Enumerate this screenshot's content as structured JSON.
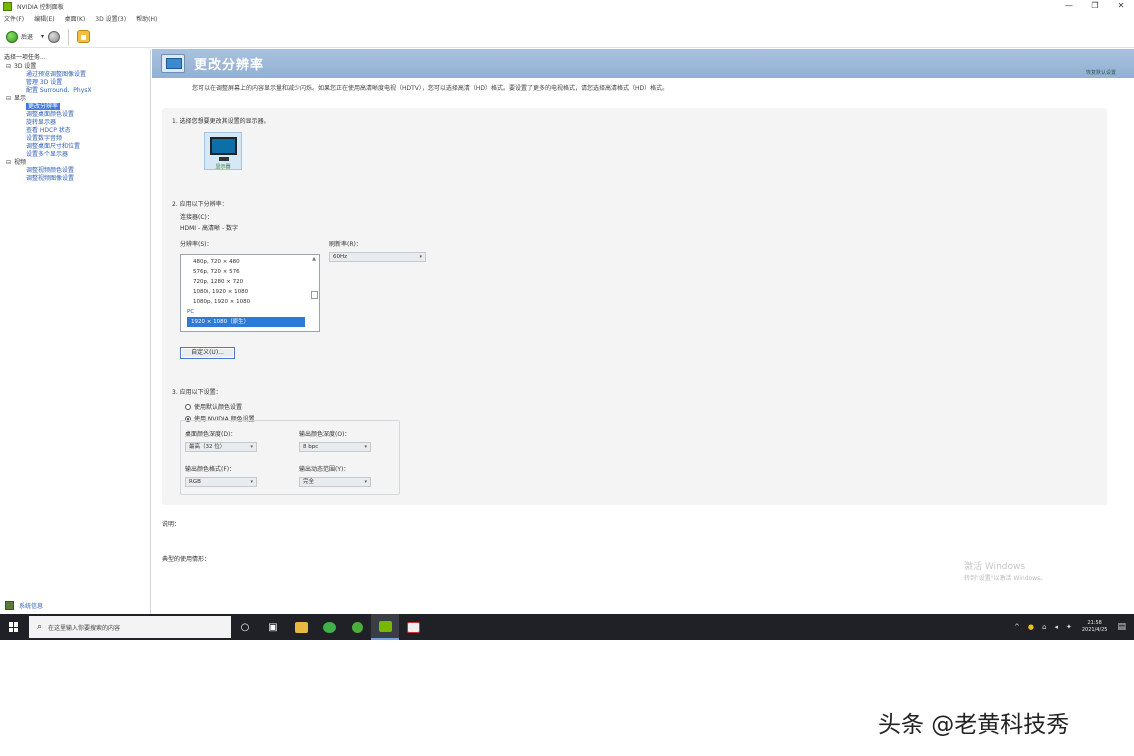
{
  "window": {
    "title": "NVIDIA 控制面板",
    "minimize": "—",
    "maximize": "❐",
    "close": "✕"
  },
  "menu": [
    "文件(F)",
    "编辑(E)",
    "桌面(K)",
    "3D 设置(3)",
    "帮助(H)"
  ],
  "toolbar": {
    "back_label": "后退",
    "dropdown_arrow": "▾"
  },
  "sidebar": {
    "header": "选择一项任务...",
    "categories": [
      {
        "name": "3D 设置",
        "expand": "⊟",
        "items": [
          "通过预览调整图像设置",
          "管理 3D 设置",
          "配置 Surround、PhysX"
        ]
      },
      {
        "name": "显示",
        "expand": "⊟",
        "items": [
          "更改分辨率",
          "调整桌面颜色设置",
          "旋转显示器",
          "查看 HDCP 状态",
          "设置数字音频",
          "调整桌面尺寸和位置",
          "设置多个显示器"
        ]
      },
      {
        "name": "视频",
        "expand": "⊟",
        "items": [
          "调整视频颜色设置",
          "调整视频图像设置"
        ]
      }
    ],
    "selected": "更改分辨率",
    "footer_link": "系统信息"
  },
  "main": {
    "banner_title": "更改分辨率",
    "restore_defaults": "恢复默认设置",
    "description": "您可以在调整屏幕上的内容显示量和减少闪烁。如果您正在使用高清晰度电视（HDTV），您可以选择高清（HD）格式。要设置了更多的电视格式，请您选择高清格式（HD）格式。",
    "section1": "1. 选择您想要更改其设置的显示器。",
    "monitor_label": "显示器",
    "section2": "2. 应用以下分辨率：",
    "connector_label": "连接器(C)：",
    "connector_value": "HDMI - 高清晰 - 数字",
    "resolution_label": "分辨率(S)：",
    "refresh_label": "刷新率(R)：",
    "refresh_value": "60Hz",
    "resolution_items": [
      "480p, 720 × 480",
      "576p, 720 × 576",
      "720p, 1280 × 720",
      "1080i, 1920 × 1080",
      "1080p, 1920 × 1080"
    ],
    "pc_label": "PC",
    "selected_resolution": "1920 × 1080（原生）",
    "custom_button": "自定义(U)...",
    "section3": "3. 应用以下设置：",
    "radio_default": "使用默认颜色设置",
    "radio_nvidia": "使用 NVIDIA 颜色设置",
    "desktop_color_depth_label": "桌面颜色深度(D)：",
    "desktop_color_depth_value": "最高（32 位）",
    "output_color_depth_label": "输出颜色深度(O)：",
    "output_color_depth_value": "8 bpc",
    "output_color_format_label": "输出颜色格式(F)：",
    "output_color_format_value": "RGB",
    "output_dynamic_range_label": "输出动态范围(Y)：",
    "output_dynamic_range_value": "完全",
    "description_label": "说明：",
    "typical_usage_label": "典型的使用情形：",
    "activate_windows_1": "激活 Windows",
    "activate_windows_2": "转到\"设置\"以激活 Windows。"
  },
  "taskbar": {
    "search_placeholder": "在这里输入你要搜索的内容",
    "tray_items": [
      "^",
      "●",
      "⌂",
      "◂",
      "✦"
    ],
    "time": "21:58",
    "date": "2021/4/25",
    "notification": "▤"
  },
  "page_watermark": "头条 @老黄科技秀",
  "colors": {
    "banner": "#93b0d3",
    "selection": "#2e7bd6",
    "link": "#2f5fb8",
    "taskbar": "#1f2126",
    "nvidia_green": "#76b900"
  }
}
